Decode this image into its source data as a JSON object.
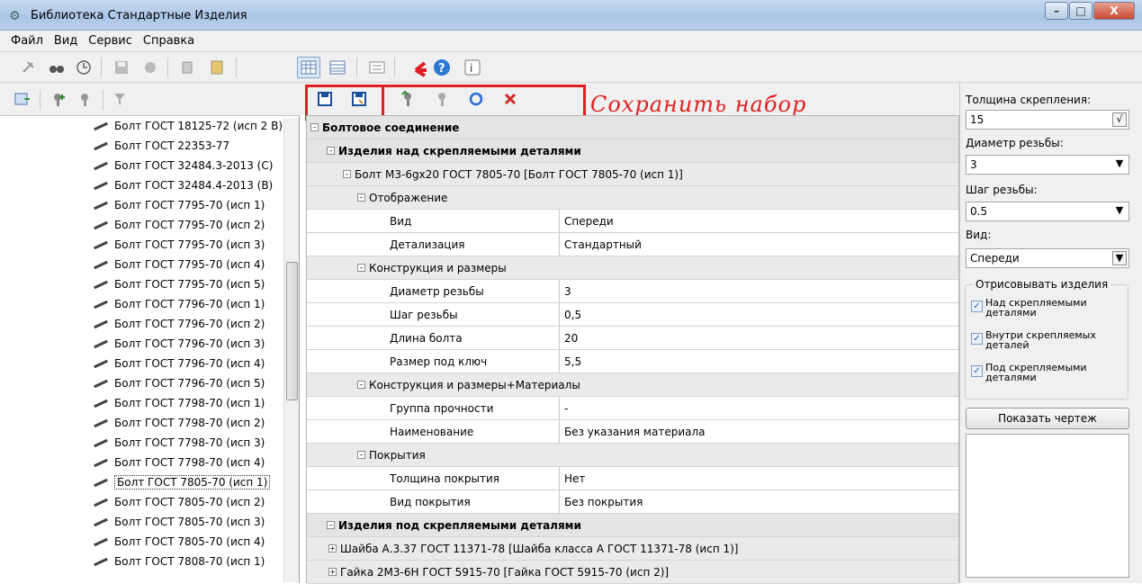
{
  "window": {
    "title": "Библиотека Стандартные Изделия",
    "close": "X"
  },
  "menu": [
    "Файл",
    "Вид",
    "Сервис",
    "Справка"
  ],
  "annotation": {
    "save_note": "Сохранить набор"
  },
  "tree": [
    "Болт ГОСТ 18125-72 (исп 2 В)",
    "Болт ГОСТ 22353-77",
    "Болт ГОСТ 32484.3-2013 (С)",
    "Болт ГОСТ 32484.4-2013 (В)",
    "Болт ГОСТ 7795-70 (исп 1)",
    "Болт ГОСТ 7795-70 (исп 2)",
    "Болт ГОСТ 7795-70 (исп 3)",
    "Болт ГОСТ 7795-70 (исп 4)",
    "Болт ГОСТ 7795-70 (исп 5)",
    "Болт ГОСТ 7796-70 (исп 1)",
    "Болт ГОСТ 7796-70 (исп 2)",
    "Болт ГОСТ 7796-70 (исп 3)",
    "Болт ГОСТ 7796-70 (исп 4)",
    "Болт ГОСТ 7796-70 (исп 5)",
    "Болт ГОСТ 7798-70 (исп 1)",
    "Болт ГОСТ 7798-70 (исп 2)",
    "Болт ГОСТ 7798-70 (исп 3)",
    "Болт ГОСТ 7798-70 (исп 4)",
    "Болт ГОСТ 7805-70 (исп 1)",
    "Болт ГОСТ 7805-70 (исп 2)",
    "Болт ГОСТ 7805-70 (исп 3)",
    "Болт ГОСТ 7805-70 (исп 4)",
    "Болт ГОСТ 7808-70 (исп 1)"
  ],
  "grid": {
    "root": "Болтовое соединение",
    "above": "Изделия над скрепляемыми деталями",
    "bolt": "Болт М3-6gx20 ГОСТ 7805-70    [Болт ГОСТ 7805-70 (исп 1)]",
    "display": "Отображение",
    "view_k": "Вид",
    "view_v": "Спереди",
    "detail_k": "Детализация",
    "detail_v": "Стандартный",
    "construct": "Конструкция и размеры",
    "diam_k": "Диаметр резьбы",
    "diam_v": "3",
    "pitch_k": "Шаг резьбы",
    "pitch_v": "0,5",
    "len_k": "Длина болта",
    "len_v": "20",
    "key_k": "Размер под ключ",
    "key_v": "5,5",
    "constructmat": "Конструкция и размеры+Материалы",
    "strength_k": "Группа прочности",
    "strength_v": "-",
    "name_k": "Наименование",
    "name_v": "Без указания материала",
    "coating": "Покрытия",
    "coatthick_k": "Толщина покрытия",
    "coatthick_v": "Нет",
    "coattype_k": "Вид покрытия",
    "coattype_v": "Без покрытия",
    "below": "Изделия под скрепляемыми деталями",
    "washer": "Шайба А.3.37 ГОСТ 11371-78    [Шайба класса А ГОСТ 11371-78 (исп 1)]",
    "nut": "Гайка 2М3-6Н ГОСТ 5915-70    [Гайка ГОСТ 5915-70 (исп 2)]"
  },
  "right": {
    "thickness_label": "Толщина скрепления:",
    "thickness_value": "15",
    "diam_label": "Диаметр резьбы:",
    "diam_value": "3",
    "pitch_label": "Шаг резьбы:",
    "pitch_value": "0.5",
    "view_label": "Вид:",
    "view_value": "Спереди",
    "group_title": "Отрисовывать изделия",
    "chk1": "Над скрепляемыми деталями",
    "chk2": "Внутри скрепляемых деталей",
    "chk3": "Под скрепляемыми деталями",
    "show_btn": "Показать чертеж"
  }
}
